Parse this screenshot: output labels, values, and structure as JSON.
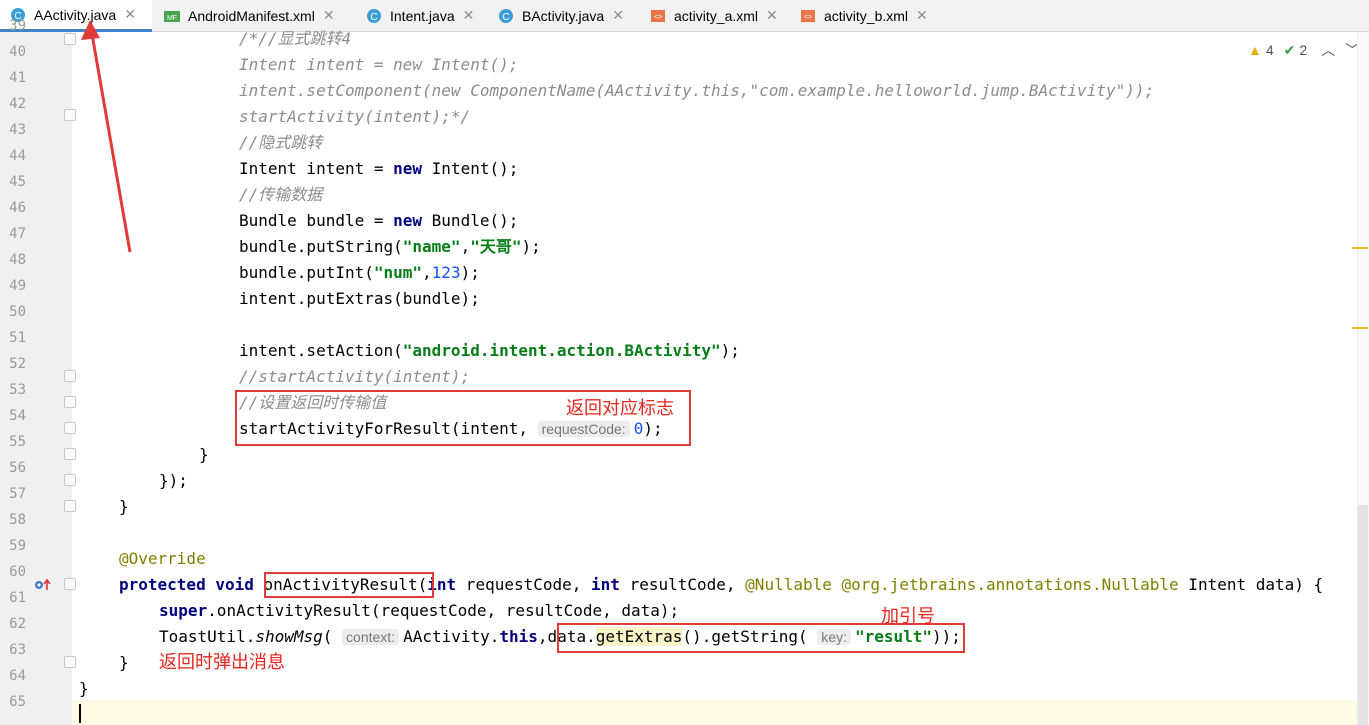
{
  "tabs": [
    {
      "label": "AActivity.java",
      "icon": "class-icon",
      "active": true
    },
    {
      "label": "AndroidManifest.xml",
      "icon": "manifest-icon",
      "active": false
    },
    {
      "label": "Intent.java",
      "icon": "class-icon",
      "active": false
    },
    {
      "label": "BActivity.java",
      "icon": "class-icon",
      "active": false
    },
    {
      "label": "activity_a.xml",
      "icon": "xml-icon",
      "active": false
    },
    {
      "label": "activity_b.xml",
      "icon": "xml-icon",
      "active": false
    }
  ],
  "inspections": {
    "warnings": "4",
    "weak_warnings": "2"
  },
  "line_numbers": [
    "39",
    "40",
    "41",
    "42",
    "43",
    "44",
    "45",
    "46",
    "47",
    "48",
    "49",
    "50",
    "51",
    "52",
    "53",
    "54",
    "55",
    "56",
    "57",
    "58",
    "59",
    "60",
    "61",
    "62",
    "63",
    "64",
    "65"
  ],
  "code": {
    "l39": "/*//显式跳转4",
    "l40": "Intent intent = new Intent();",
    "l41": "intent.setComponent(new ComponentName(AActivity.this,\"com.example.helloworld.jump.BActivity\"));",
    "l42": "startActivity(intent);*/",
    "l43": "//隐式跳转",
    "l44a": "Intent intent = ",
    "l44b": "new",
    "l44c": " Intent();",
    "l45": "//传输数据",
    "l46a": "Bundle bundle = ",
    "l46b": "new",
    "l46c": " Bundle();",
    "l47a": "bundle.putString(",
    "l47b": "\"name\"",
    "l47c": ",",
    "l47d": "\"天哥\"",
    "l47e": ");",
    "l48a": "bundle.putInt(",
    "l48b": "\"num\"",
    "l48c": ",",
    "l48d": "123",
    "l48e": ");",
    "l49": "intent.putExtras(bundle);",
    "l51a": "intent.setAction(",
    "l51b": "\"android.intent.action.BActivity\"",
    "l51c": ");",
    "l52": "//startActivity(intent);",
    "l53": "//设置返回时传输值",
    "l54a": "startActivityForResult(intent, ",
    "l54hint": "requestCode:",
    "l54b": "0",
    "l54c": ");",
    "l55": "}",
    "l56": "});",
    "l57": "}",
    "l59": "@Override",
    "l60a": "protected",
    "l60b": " ",
    "l60c": "void",
    "l60d": " onActivityResult(",
    "l60e": "int",
    "l60f": " requestCode, ",
    "l60g": "int",
    "l60h": " resultCode, ",
    "l60i": "@Nullable",
    "l60j": " ",
    "l60k": "@org.jetbrains.annotations.Nullable",
    "l60l": " Intent data) {",
    "l61a": "super",
    "l61b": ".onActivityResult(requestCode, resultCode, data);",
    "l62a": "ToastUtil.",
    "l62b": "showMsg",
    "l62c": "( ",
    "l62hint1": "context:",
    "l62d": "AActivity.",
    "l62e": "this",
    "l62f": ",data.",
    "l62g": "getExtras",
    "l62h": "().getString( ",
    "l62hint2": "key:",
    "l62i": "\"result\"",
    "l62j": "));",
    "l63": "}",
    "l64": "}"
  },
  "notes": {
    "return_flag": "返回对应标志",
    "add_quotes": "加引号",
    "popup_msg": "返回时弹出消息"
  },
  "colors": {
    "annotation_red": "#e03a3a",
    "keyword": "#000080",
    "string": "#067d17",
    "number": "#1750eb",
    "comment": "#8c8c8c"
  }
}
